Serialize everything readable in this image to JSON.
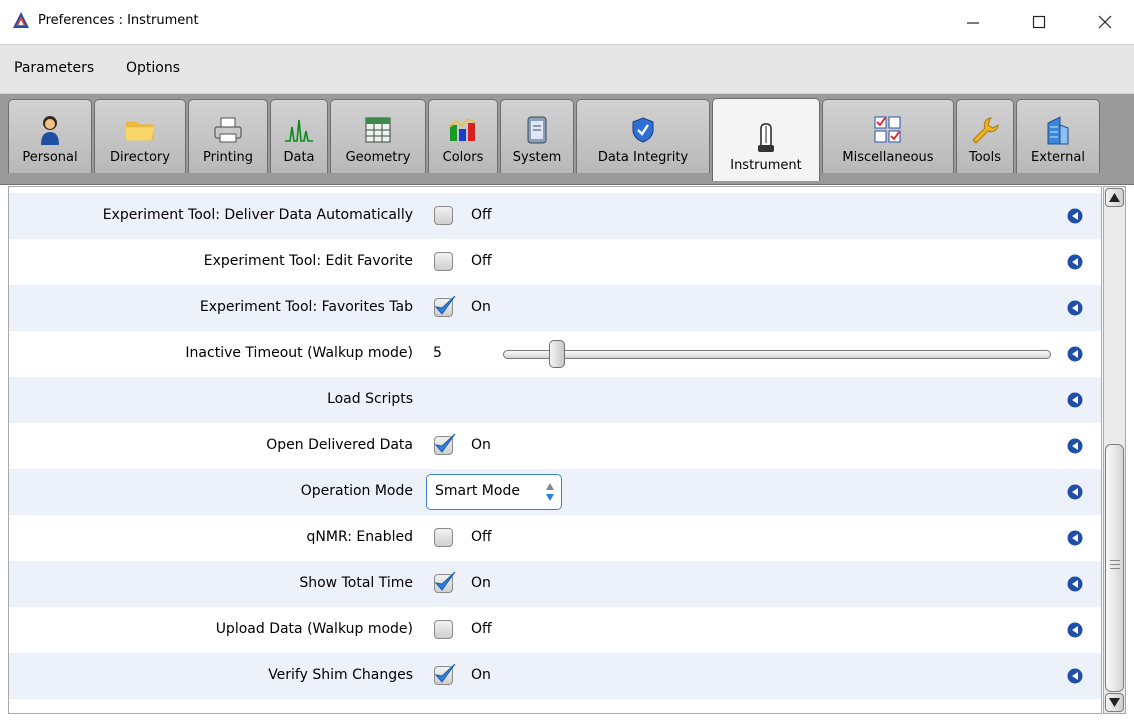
{
  "window": {
    "title": "Preferences : Instrument"
  },
  "menubar": {
    "items": [
      "Parameters",
      "Options"
    ]
  },
  "tabs": [
    {
      "label": "Personal",
      "icon": "person-icon"
    },
    {
      "label": "Directory",
      "icon": "folder-icon"
    },
    {
      "label": "Printing",
      "icon": "printer-icon"
    },
    {
      "label": "Data",
      "icon": "spectrum-icon"
    },
    {
      "label": "Geometry",
      "icon": "grid-icon"
    },
    {
      "label": "Colors",
      "icon": "colors-icon"
    },
    {
      "label": "System",
      "icon": "system-icon"
    },
    {
      "label": "Data Integrity",
      "icon": "shield-icon"
    },
    {
      "label": "Instrument",
      "icon": "magnet-icon",
      "active": true
    },
    {
      "label": "Miscellaneous",
      "icon": "checklist-icon"
    },
    {
      "label": "Tools",
      "icon": "wrench-icon"
    },
    {
      "label": "External",
      "icon": "building-icon"
    }
  ],
  "rows": [
    {
      "label": "Experiment Tool: Deliver Data Automatically",
      "type": "checkbox",
      "checked": false,
      "value": "Off"
    },
    {
      "label": "Experiment Tool: Edit Favorite",
      "type": "checkbox",
      "checked": false,
      "value": "Off"
    },
    {
      "label": "Experiment Tool: Favorites Tab",
      "type": "checkbox",
      "checked": true,
      "value": "On"
    },
    {
      "label": "Inactive Timeout (Walkup mode)",
      "type": "slider",
      "value": "5",
      "slider_fraction": 0.07
    },
    {
      "label": "Load Scripts",
      "type": "none"
    },
    {
      "label": "Open Delivered Data",
      "type": "checkbox",
      "checked": true,
      "value": "On"
    },
    {
      "label": "Operation Mode",
      "type": "select",
      "value": "Smart Mode"
    },
    {
      "label": "qNMR: Enabled",
      "type": "checkbox",
      "checked": false,
      "value": "Off"
    },
    {
      "label": "Show Total Time",
      "type": "checkbox",
      "checked": true,
      "value": "On"
    },
    {
      "label": "Upload Data (Walkup mode)",
      "type": "checkbox",
      "checked": false,
      "value": "Off"
    },
    {
      "label": "Verify Shim Changes",
      "type": "checkbox",
      "checked": true,
      "value": "On"
    }
  ],
  "colors": {
    "row_alt": "#edf1fa",
    "accent": "#2f7fe0",
    "tabbar": "#9a9a9a"
  }
}
